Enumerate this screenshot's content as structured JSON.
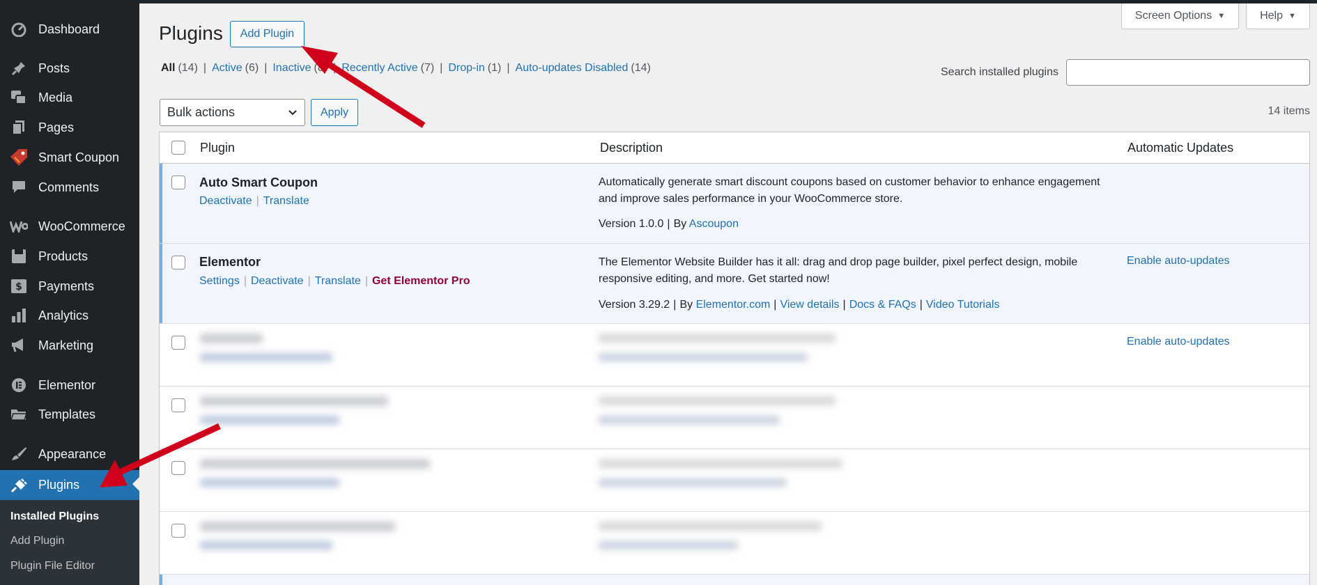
{
  "sidebar": {
    "items": [
      {
        "label": "Dashboard",
        "icon": "dashboard-icon"
      },
      {
        "label": "Posts",
        "icon": "pin-icon"
      },
      {
        "label": "Media",
        "icon": "media-icon"
      },
      {
        "label": "Pages",
        "icon": "pages-icon"
      },
      {
        "label": "Smart Coupon",
        "icon": "coupon-icon"
      },
      {
        "label": "Comments",
        "icon": "comment-icon"
      },
      {
        "label": "WooCommerce",
        "icon": "woocommerce-icon"
      },
      {
        "label": "Products",
        "icon": "products-icon"
      },
      {
        "label": "Payments",
        "icon": "payments-icon"
      },
      {
        "label": "Analytics",
        "icon": "analytics-icon"
      },
      {
        "label": "Marketing",
        "icon": "megaphone-icon"
      },
      {
        "label": "Elementor",
        "icon": "elementor-icon"
      },
      {
        "label": "Templates",
        "icon": "folder-icon"
      },
      {
        "label": "Appearance",
        "icon": "brush-icon"
      },
      {
        "label": "Plugins",
        "icon": "plug-icon"
      }
    ],
    "submenu": [
      "Installed Plugins",
      "Add Plugin",
      "Plugin File Editor"
    ]
  },
  "header": {
    "title": "Plugins",
    "add_button": "Add Plugin",
    "screen_options": "Screen Options",
    "help": "Help"
  },
  "filters": [
    {
      "label": "All",
      "count": "(14)"
    },
    {
      "label": "Active",
      "count": "(6)"
    },
    {
      "label": "Inactive",
      "count": "(8)"
    },
    {
      "label": "Recently Active",
      "count": "(7)"
    },
    {
      "label": "Drop-in",
      "count": "(1)"
    },
    {
      "label": "Auto-updates Disabled",
      "count": "(14)"
    }
  ],
  "search": {
    "label": "Search installed plugins",
    "value": ""
  },
  "bulk": {
    "selected": "Bulk actions",
    "apply": "Apply",
    "items_count": "14 items"
  },
  "table": {
    "columns": [
      "Plugin",
      "Description",
      "Automatic Updates"
    ],
    "rows": [
      {
        "name": "Auto Smart Coupon",
        "actions": [
          "Deactivate",
          "Translate"
        ],
        "description": "Automatically generate smart discount coupons based on customer behavior to enhance engagement and improve sales performance in your WooCommerce store.",
        "version": "Version 1.0.0",
        "by": "By",
        "author": "Ascoupon",
        "auto_update": ""
      },
      {
        "name": "Elementor",
        "actions": [
          "Settings",
          "Deactivate",
          "Translate"
        ],
        "pro_action": "Get Elementor Pro",
        "description": "The Elementor Website Builder has it all: drag and drop page builder, pixel perfect design, mobile responsive editing, and more. Get started now!",
        "version": "Version 3.29.2",
        "by": "By",
        "author": "Elementor.com",
        "links": [
          "View details",
          "Docs & FAQs",
          "Video Tutorials"
        ],
        "auto_update": "Enable auto-updates"
      },
      {
        "auto_update": "Enable auto-updates"
      }
    ]
  },
  "colors": {
    "sidebar_bg": "#1d2327",
    "accent": "#2271b1",
    "arrow": "#d0021b",
    "pro": "#92003b"
  }
}
